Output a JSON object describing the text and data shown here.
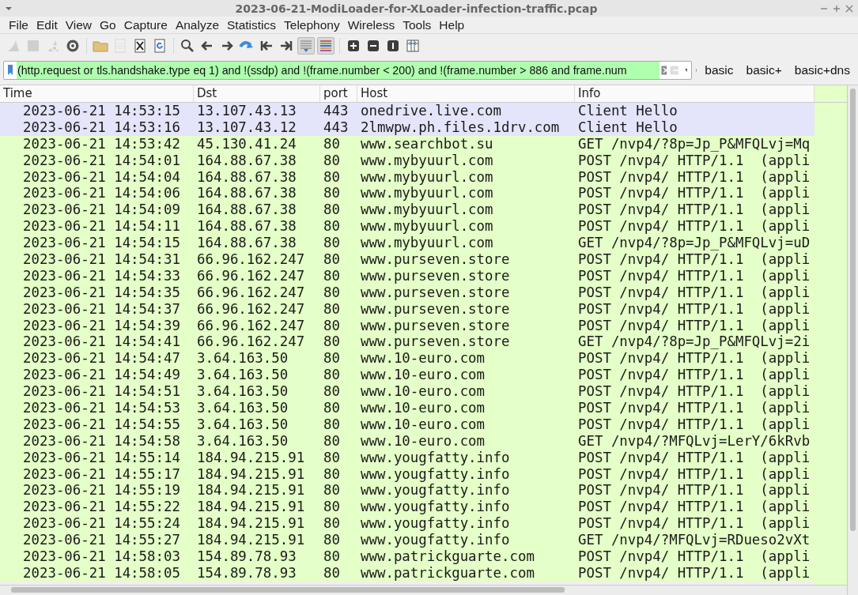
{
  "window": {
    "title": "2023-06-21-ModiLoader-for-XLoader-infection-traffic.pcap"
  },
  "menu": [
    "File",
    "Edit",
    "View",
    "Go",
    "Capture",
    "Analyze",
    "Statistics",
    "Telephony",
    "Wireless",
    "Tools",
    "Help"
  ],
  "toolbar": [
    {
      "kind": "fin",
      "disabled": true
    },
    {
      "kind": "stop",
      "disabled": true
    },
    {
      "kind": "restart",
      "disabled": true
    },
    {
      "kind": "gear"
    },
    {
      "kind": "sep"
    },
    {
      "kind": "folder"
    },
    {
      "kind": "file",
      "disabled": true
    },
    {
      "kind": "closefile"
    },
    {
      "kind": "reload"
    },
    {
      "kind": "sep"
    },
    {
      "kind": "search"
    },
    {
      "kind": "left"
    },
    {
      "kind": "right"
    },
    {
      "kind": "jump"
    },
    {
      "kind": "first"
    },
    {
      "kind": "last"
    },
    {
      "kind": "autoscroll",
      "pressed": true
    },
    {
      "kind": "colorize",
      "pressed": true
    },
    {
      "kind": "sep"
    },
    {
      "kind": "zoomin"
    },
    {
      "kind": "zoomout"
    },
    {
      "kind": "normal"
    },
    {
      "kind": "columns"
    }
  ],
  "filter": {
    "value": "(http.request or tls.handshake.type eq 1) and !(ssdp) and !(frame.number < 200) and !(frame.number > 886 and frame.num",
    "valid": true
  },
  "filter_buttons": [
    "basic",
    "basic+",
    "basic+dns"
  ],
  "table": {
    "columns": [
      "Time",
      "Dst",
      "port",
      "Host",
      "Info"
    ],
    "rows": [
      {
        "cells": [
          "2023-06-21 14:53:15",
          "13.107.43.13",
          "443",
          "onedrive.live.com",
          "Client Hello"
        ],
        "color": "#e4e4fa"
      },
      {
        "cells": [
          "2023-06-21 14:53:16",
          "13.107.43.12",
          "443",
          "2lmwpw.ph.files.1drv.com",
          "Client Hello"
        ],
        "color": "#e4e4fa"
      },
      {
        "cells": [
          "2023-06-21 14:53:42",
          "45.130.41.24",
          "80",
          "www.searchbot.su",
          "GET /nvp4/?8p=Jp_P&MFQLvj=Mq"
        ],
        "color": "#e4ffc7"
      },
      {
        "cells": [
          "2023-06-21 14:54:01",
          "164.88.67.38",
          "80",
          "www.mybyuurl.com",
          "POST /nvp4/ HTTP/1.1  (appli"
        ],
        "color": "#e4ffc7"
      },
      {
        "cells": [
          "2023-06-21 14:54:04",
          "164.88.67.38",
          "80",
          "www.mybyuurl.com",
          "POST /nvp4/ HTTP/1.1  (appli"
        ],
        "color": "#e4ffc7"
      },
      {
        "cells": [
          "2023-06-21 14:54:06",
          "164.88.67.38",
          "80",
          "www.mybyuurl.com",
          "POST /nvp4/ HTTP/1.1  (appli"
        ],
        "color": "#e4ffc7"
      },
      {
        "cells": [
          "2023-06-21 14:54:09",
          "164.88.67.38",
          "80",
          "www.mybyuurl.com",
          "POST /nvp4/ HTTP/1.1  (appli"
        ],
        "color": "#e4ffc7"
      },
      {
        "cells": [
          "2023-06-21 14:54:11",
          "164.88.67.38",
          "80",
          "www.mybyuurl.com",
          "POST /nvp4/ HTTP/1.1  (appli"
        ],
        "color": "#e4ffc7"
      },
      {
        "cells": [
          "2023-06-21 14:54:15",
          "164.88.67.38",
          "80",
          "www.mybyuurl.com",
          "GET /nvp4/?8p=Jp_P&MFQLvj=uD"
        ],
        "color": "#e4ffc7"
      },
      {
        "cells": [
          "2023-06-21 14:54:31",
          "66.96.162.247",
          "80",
          "www.purseven.store",
          "POST /nvp4/ HTTP/1.1  (appli"
        ],
        "color": "#e4ffc7"
      },
      {
        "cells": [
          "2023-06-21 14:54:33",
          "66.96.162.247",
          "80",
          "www.purseven.store",
          "POST /nvp4/ HTTP/1.1  (appli"
        ],
        "color": "#e4ffc7"
      },
      {
        "cells": [
          "2023-06-21 14:54:35",
          "66.96.162.247",
          "80",
          "www.purseven.store",
          "POST /nvp4/ HTTP/1.1  (appli"
        ],
        "color": "#e4ffc7"
      },
      {
        "cells": [
          "2023-06-21 14:54:37",
          "66.96.162.247",
          "80",
          "www.purseven.store",
          "POST /nvp4/ HTTP/1.1  (appli"
        ],
        "color": "#e4ffc7"
      },
      {
        "cells": [
          "2023-06-21 14:54:39",
          "66.96.162.247",
          "80",
          "www.purseven.store",
          "POST /nvp4/ HTTP/1.1  (appli"
        ],
        "color": "#e4ffc7"
      },
      {
        "cells": [
          "2023-06-21 14:54:41",
          "66.96.162.247",
          "80",
          "www.purseven.store",
          "GET /nvp4/?8p=Jp_P&MFQLvj=2i"
        ],
        "color": "#e4ffc7"
      },
      {
        "cells": [
          "2023-06-21 14:54:47",
          "3.64.163.50",
          "80",
          "www.10-euro.com",
          "POST /nvp4/ HTTP/1.1  (appli"
        ],
        "color": "#e4ffc7"
      },
      {
        "cells": [
          "2023-06-21 14:54:49",
          "3.64.163.50",
          "80",
          "www.10-euro.com",
          "POST /nvp4/ HTTP/1.1  (appli"
        ],
        "color": "#e4ffc7"
      },
      {
        "cells": [
          "2023-06-21 14:54:51",
          "3.64.163.50",
          "80",
          "www.10-euro.com",
          "POST /nvp4/ HTTP/1.1  (appli"
        ],
        "color": "#e4ffc7"
      },
      {
        "cells": [
          "2023-06-21 14:54:53",
          "3.64.163.50",
          "80",
          "www.10-euro.com",
          "POST /nvp4/ HTTP/1.1  (appli"
        ],
        "color": "#e4ffc7"
      },
      {
        "cells": [
          "2023-06-21 14:54:55",
          "3.64.163.50",
          "80",
          "www.10-euro.com",
          "POST /nvp4/ HTTP/1.1  (appli"
        ],
        "color": "#e4ffc7"
      },
      {
        "cells": [
          "2023-06-21 14:54:58",
          "3.64.163.50",
          "80",
          "www.10-euro.com",
          "GET /nvp4/?MFQLvj=LerY/6kRvb"
        ],
        "color": "#e4ffc7"
      },
      {
        "cells": [
          "2023-06-21 14:55:14",
          "184.94.215.91",
          "80",
          "www.yougfatty.info",
          "POST /nvp4/ HTTP/1.1  (appli"
        ],
        "color": "#e4ffc7"
      },
      {
        "cells": [
          "2023-06-21 14:55:17",
          "184.94.215.91",
          "80",
          "www.yougfatty.info",
          "POST /nvp4/ HTTP/1.1  (appli"
        ],
        "color": "#e4ffc7"
      },
      {
        "cells": [
          "2023-06-21 14:55:19",
          "184.94.215.91",
          "80",
          "www.yougfatty.info",
          "POST /nvp4/ HTTP/1.1  (appli"
        ],
        "color": "#e4ffc7"
      },
      {
        "cells": [
          "2023-06-21 14:55:22",
          "184.94.215.91",
          "80",
          "www.yougfatty.info",
          "POST /nvp4/ HTTP/1.1  (appli"
        ],
        "color": "#e4ffc7"
      },
      {
        "cells": [
          "2023-06-21 14:55:24",
          "184.94.215.91",
          "80",
          "www.yougfatty.info",
          "POST /nvp4/ HTTP/1.1  (appli"
        ],
        "color": "#e4ffc7"
      },
      {
        "cells": [
          "2023-06-21 14:55:27",
          "184.94.215.91",
          "80",
          "www.yougfatty.info",
          "GET /nvp4/?MFQLvj=RDueso2vXt"
        ],
        "color": "#e4ffc7"
      },
      {
        "cells": [
          "2023-06-21 14:58:03",
          "154.89.78.93",
          "80",
          "www.patrickguarte.com",
          "POST /nvp4/ HTTP/1.1  (appli"
        ],
        "color": "#e4ffc7"
      },
      {
        "cells": [
          "2023-06-21 14:58:05",
          "154.89.78.93",
          "80",
          "www.patrickguarte.com",
          "POST /nvp4/ HTTP/1.1  (appli"
        ],
        "color": "#e4ffc7"
      }
    ]
  }
}
